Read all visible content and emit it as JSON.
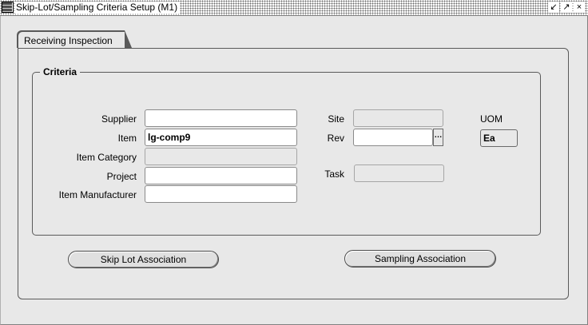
{
  "window": {
    "title": "Skip-Lot/Sampling Criteria Setup (M1)",
    "controls": [
      "↙",
      "↗",
      "×"
    ]
  },
  "tabs": [
    {
      "label": "Receiving Inspection"
    }
  ],
  "criteria": {
    "title": "Criteria",
    "supplier": {
      "label": "Supplier",
      "value": ""
    },
    "item": {
      "label": "Item",
      "value": "lg-comp9"
    },
    "item_category": {
      "label": "Item Category",
      "value": ""
    },
    "project": {
      "label": "Project",
      "value": ""
    },
    "item_manufacturer": {
      "label": "Item Manufacturer",
      "value": ""
    },
    "site": {
      "label": "Site",
      "value": ""
    },
    "rev": {
      "label": "Rev",
      "value": "",
      "lov": "…"
    },
    "task": {
      "label": "Task",
      "value": ""
    },
    "uom": {
      "label": "UOM",
      "value": "Ea"
    }
  },
  "buttons": {
    "skip_lot": "Skip Lot Association",
    "sampling": "Sampling Association"
  }
}
